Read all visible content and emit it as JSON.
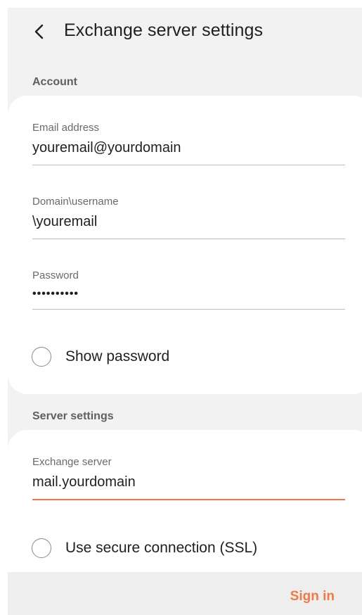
{
  "header": {
    "title": "Exchange server settings",
    "back_icon": "chevron-left-icon"
  },
  "account": {
    "section_label": "Account",
    "email": {
      "label": "Email address",
      "value": "youremail@yourdomain"
    },
    "username": {
      "label": "Domain\\username",
      "value": "\\youremail"
    },
    "password": {
      "label": "Password",
      "value": "••••••••••"
    },
    "show_password": {
      "label": "Show password",
      "checked": false
    }
  },
  "server": {
    "section_label": "Server settings",
    "exchange_server": {
      "label": "Exchange server",
      "value": "mail.yourdomain"
    },
    "ssl": {
      "label": "Use secure connection (SSL)",
      "checked": false
    }
  },
  "footer": {
    "sign_in_label": "Sign in"
  },
  "colors": {
    "accent": "#ef7a45",
    "background": "#f2f2f2",
    "card": "#ffffff"
  }
}
